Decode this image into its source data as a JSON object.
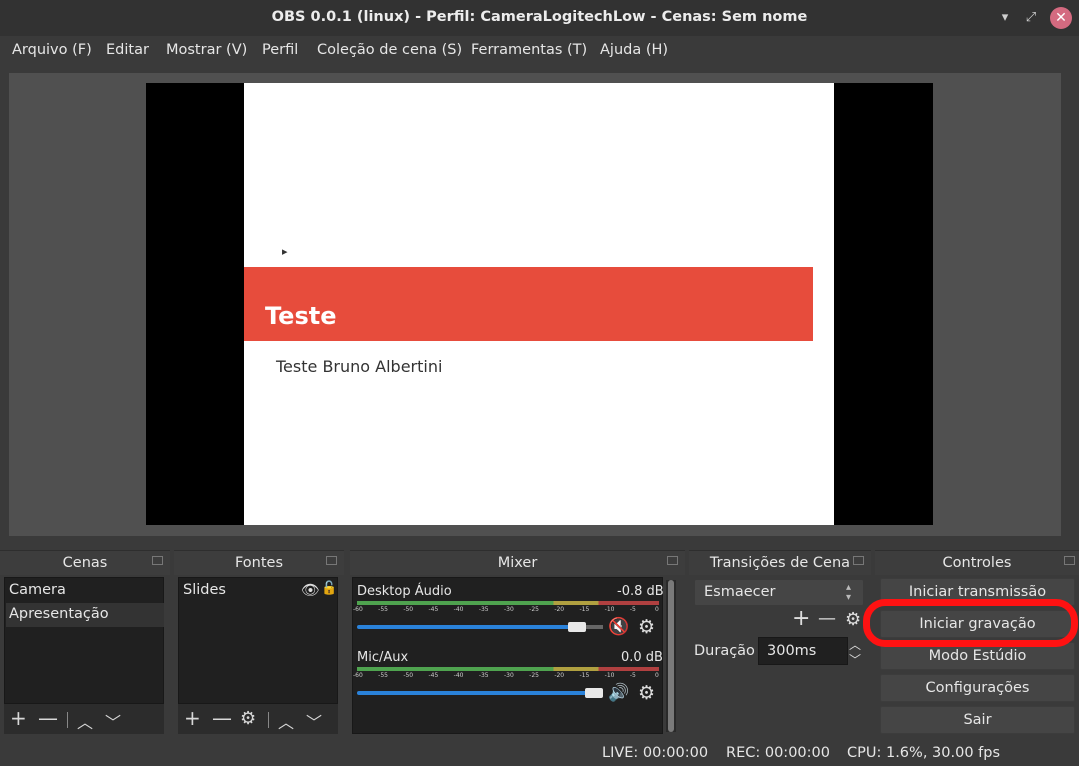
{
  "window": {
    "title": "OBS 0.0.1 (linux) - Perfil: CameraLogitechLow - Cenas: Sem nome"
  },
  "menu": [
    "Arquivo (F)",
    "Editar",
    "Mostrar (V)",
    "Perfil",
    "Coleção de cena (S)",
    "Ferramentas (T)",
    "Ajuda (H)"
  ],
  "preview": {
    "slide_title": "Teste",
    "slide_subtitle": "Teste Bruno Albertini"
  },
  "docks": {
    "scenes": {
      "title": "Cenas",
      "items": [
        "Camera",
        "Apresentação"
      ],
      "selected": "Apresentação"
    },
    "sources": {
      "title": "Fontes",
      "items": [
        "Slides"
      ]
    },
    "mixer": {
      "title": "Mixer",
      "channels": [
        {
          "name": "Desktop Áudio",
          "level": "-0.8 dB",
          "muted": true,
          "volume_fraction": 0.93
        },
        {
          "name": "Mic/Aux",
          "level": "0.0 dB",
          "muted": false,
          "volume_fraction": 1.0
        }
      ],
      "ticks": [
        "-60",
        "-55",
        "-50",
        "-45",
        "-40",
        "-35",
        "-30",
        "-25",
        "-20",
        "-15",
        "-10",
        "-5",
        "0"
      ]
    },
    "transitions": {
      "title": "Transições de Cena",
      "selected": "Esmaecer",
      "duration_label": "Duração",
      "duration_value": "300ms"
    },
    "controls": {
      "title": "Controles",
      "buttons": [
        "Iniciar transmissão",
        "Iniciar gravação",
        "Modo Estúdio",
        "Configurações",
        "Sair"
      ]
    }
  },
  "status": {
    "live": "LIVE: 00:00:00",
    "rec": "REC: 00:00:00",
    "cpu": "CPU: 1.6%, 30.00 fps"
  },
  "colors": {
    "accent_blue": "#2a82da",
    "slide_bar": "#e74c3c",
    "highlight_ring": "#ff1212",
    "close_button": "#d46a80"
  }
}
